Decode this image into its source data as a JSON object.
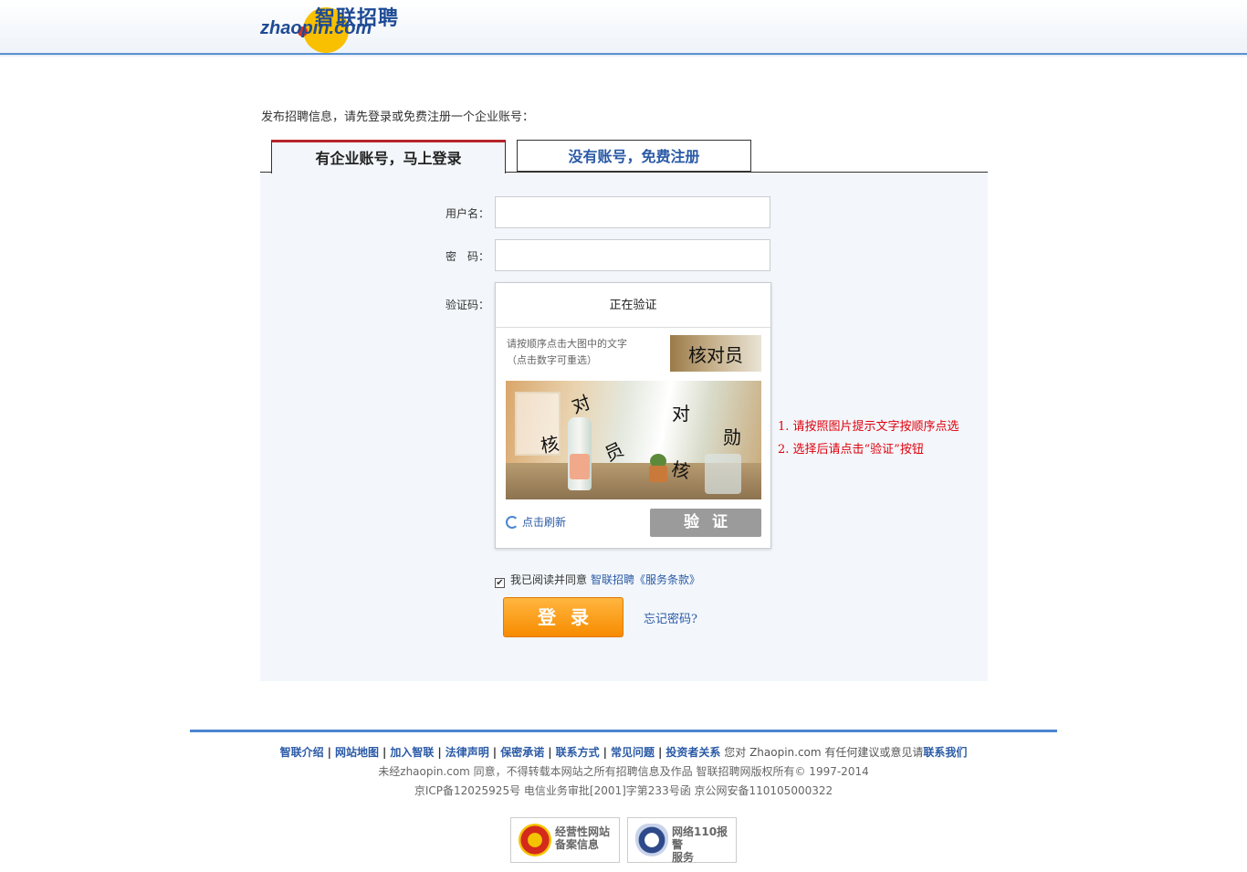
{
  "header": {
    "logo_cn": "智联招聘",
    "logo_en": "zhaopin.com"
  },
  "intro": "发布招聘信息，请先登录或免费注册一个企业账号：",
  "tabs": {
    "login": "有企业账号，马上登录",
    "register": "没有账号，免费注册"
  },
  "form": {
    "username_label": "用户名：",
    "password_label": "密　码：",
    "captcha_label": "验证码：",
    "username_value": "",
    "password_value": ""
  },
  "captcha": {
    "status": "正在验证",
    "hint_line1": "请按顺序点击大图中的文字",
    "hint_line2": "（点击数字可重选）",
    "target_chars": "核对员",
    "image_chars": [
      "对",
      "对",
      "核",
      "勋",
      "员",
      "核"
    ],
    "refresh_label": "点击刷新",
    "verify_label": "验证"
  },
  "tips": {
    "line1": "1. 请按照图片提示文字按顺序点选",
    "line2": "2. 选择后请点击“验证”按钮"
  },
  "agree": {
    "checked": true,
    "check_glyph": "✔",
    "text": "我已阅读并同意",
    "terms": "智联招聘《服务条款》"
  },
  "login_button": "登录",
  "forgot_password": "忘记密码?",
  "footer": {
    "links": [
      "智联介绍",
      "网站地图",
      "加入智联",
      "法律声明",
      "保密承诺",
      "联系方式",
      "常见问题",
      "投资者关系"
    ],
    "suggest_pre": "您对 Zhaopin.com 有任何建议或意见请",
    "contact": "联系我们",
    "copyright": "未经zhaopin.com 同意，不得转载本网站之所有招聘信息及作品 智联招聘网版权所有© 1997-2014",
    "icp": "京ICP备12025925号 电信业务审批[2001]字第233号函 京公网安备110105000322",
    "badges": [
      {
        "line1": "经营性网站",
        "line2": "备案信息",
        "icon": "business-registration-icon"
      },
      {
        "line1": "网络110报警",
        "line2": "服务",
        "icon": "police-110-icon"
      }
    ]
  },
  "colors": {
    "brand_blue": "#1e4b95",
    "link_blue": "#2a5aa6",
    "tab_accent": "#b8242a",
    "tip_red": "#e0000c",
    "login_orange": "#f78b00",
    "panel_bg": "#f3f7fb"
  }
}
